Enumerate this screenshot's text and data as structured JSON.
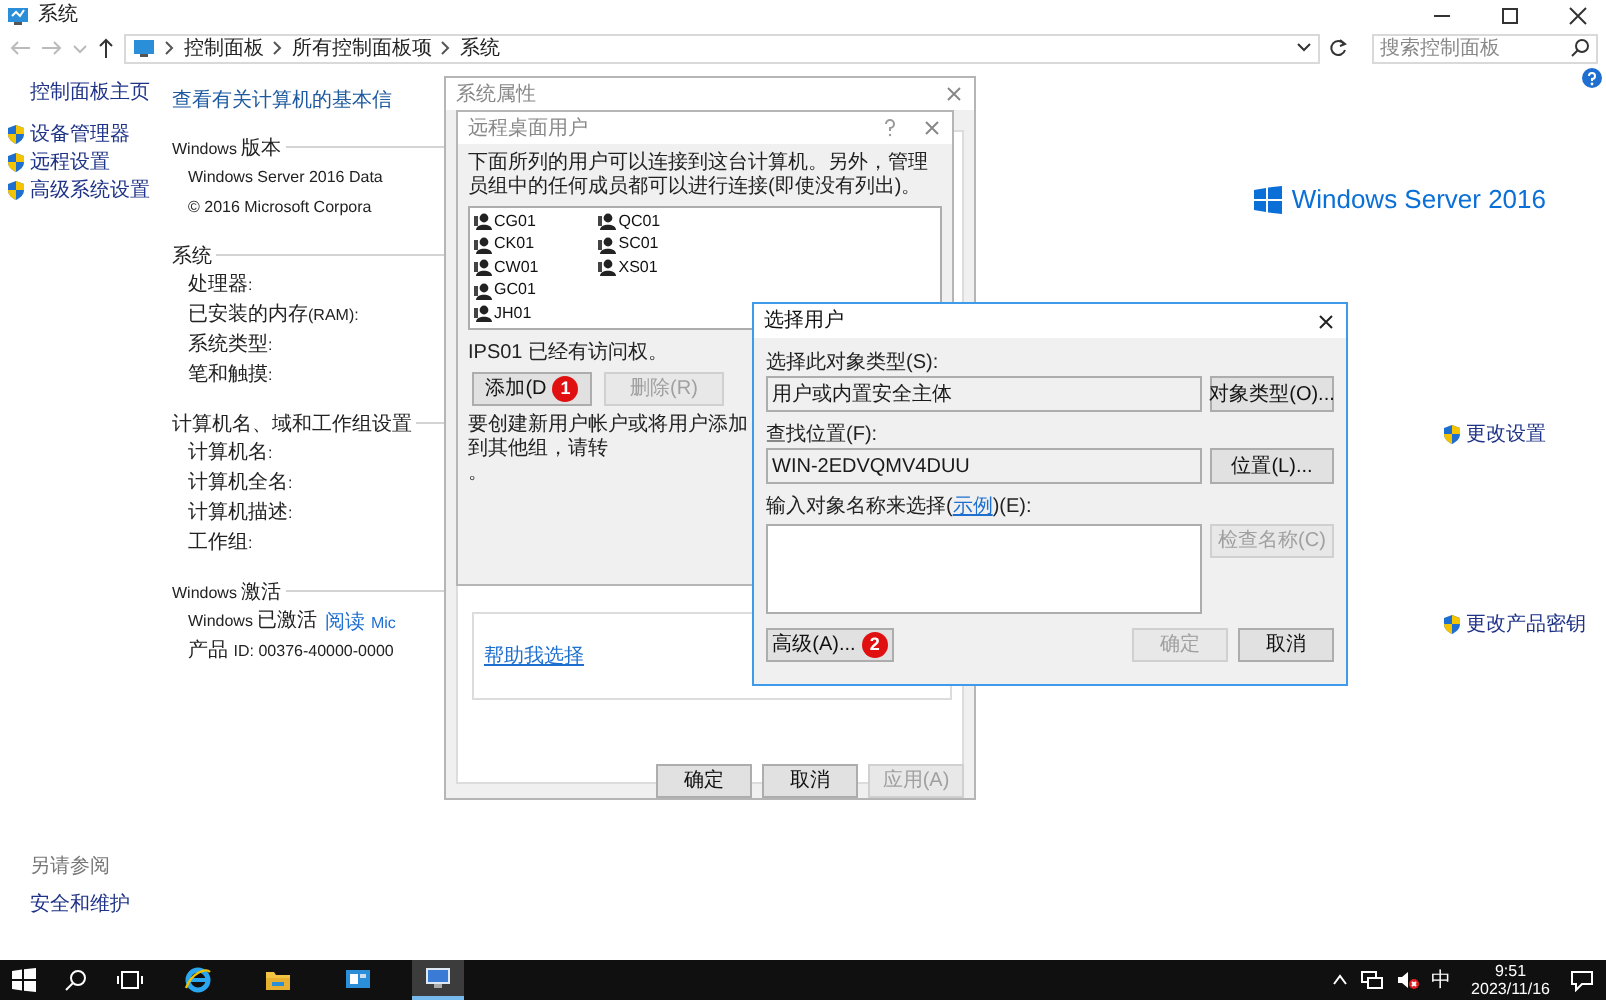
{
  "window": {
    "title": "系统"
  },
  "address_bar": {
    "path": [
      "控制面板",
      "所有控制面板项",
      "系统"
    ]
  },
  "search": {
    "placeholder": "搜索控制面板"
  },
  "sidebar": {
    "home": "控制面板主页",
    "items": [
      {
        "label": "设备管理器"
      },
      {
        "label": "远程设置"
      },
      {
        "label": "高级系统设置"
      }
    ],
    "see_also_title": "另请参阅",
    "see_also": [
      "安全和维护"
    ]
  },
  "main": {
    "heading": "查看有关计算机的基本信",
    "sections": [
      {
        "title": "Windows 版本",
        "rows": [
          {
            "text": "Windows Server 2016 Data"
          },
          {
            "text": "© 2016 Microsoft Corpora"
          }
        ]
      },
      {
        "title": "系统",
        "rows": [
          {
            "text": "处理器:"
          },
          {
            "text": "已安装的内存(RAM):"
          },
          {
            "text": "系统类型:"
          },
          {
            "text": "笔和触摸:"
          }
        ]
      },
      {
        "title": "计算机名、域和工作组设置",
        "rows": [
          {
            "text": "计算机名:"
          },
          {
            "text": "计算机全名:"
          },
          {
            "text": "计算机描述:"
          },
          {
            "text": "工作组:"
          }
        ]
      },
      {
        "title": "Windows 激活",
        "rows": [
          {
            "text": "Windows 已激活",
            "link": "阅读 Mic"
          },
          {
            "text": "产品 ID: 00376-40000-0000"
          }
        ]
      }
    ]
  },
  "brand": "Windows Server 2016",
  "change_settings": "更改设置",
  "change_key": "更改产品密钥",
  "system_properties": {
    "title": "系统属性",
    "help_link": "帮助我选择",
    "buttons": [
      {
        "label": "确定",
        "disabled": false
      },
      {
        "label": "取消",
        "disabled": false
      },
      {
        "label": "应用(A)",
        "disabled": true
      }
    ]
  },
  "remote_desktop_users": {
    "title": "远程桌面用户",
    "intro": "下面所列的用户可以连接到这台计算机。另外，管理员组中的任何成员都可以进行连接(即使没有列出)。",
    "users": [
      "CG01",
      "CK01",
      "CW01",
      "GC01",
      "JH01",
      "QC01",
      "SC01",
      "XS01"
    ],
    "access_note": "IPS01 已经有访问权。",
    "buttons": [
      {
        "label": "添加(D",
        "disabled": false,
        "badge": "1"
      },
      {
        "label": "删除(R)",
        "disabled": true
      }
    ],
    "create_note": "要创建新用户帐户或将用户添加到其他组，请转",
    "create_note_end": "。"
  },
  "select_users": {
    "title": "选择用户",
    "object_type_label": "选择此对象类型(S):",
    "object_type": "用户或内置安全主体",
    "object_type_button": "对象类型(O)...",
    "location_label": "查找位置(F):",
    "location": "WIN-2EDVQMV4DUU",
    "location_button": "位置(L)...",
    "names_label_before": "输入对象名称来选择(",
    "names_link": "示例",
    "names_label_after": ")(E):",
    "buttons": [
      {
        "label": "检查名称(C)",
        "disabled": true
      },
      {
        "label": "高级(A)...",
        "disabled": false,
        "badge": "2"
      },
      {
        "label": "确定",
        "disabled": true
      },
      {
        "label": "取消",
        "disabled": false
      }
    ]
  },
  "taskbar": {
    "apps": [
      {
        "kind": "ie",
        "active": false
      },
      {
        "kind": "folder",
        "active": false
      },
      {
        "kind": "server",
        "active": false
      },
      {
        "kind": "system",
        "active": true
      }
    ],
    "ime": "中",
    "time": "9:51",
    "date": "2023/11/16"
  }
}
